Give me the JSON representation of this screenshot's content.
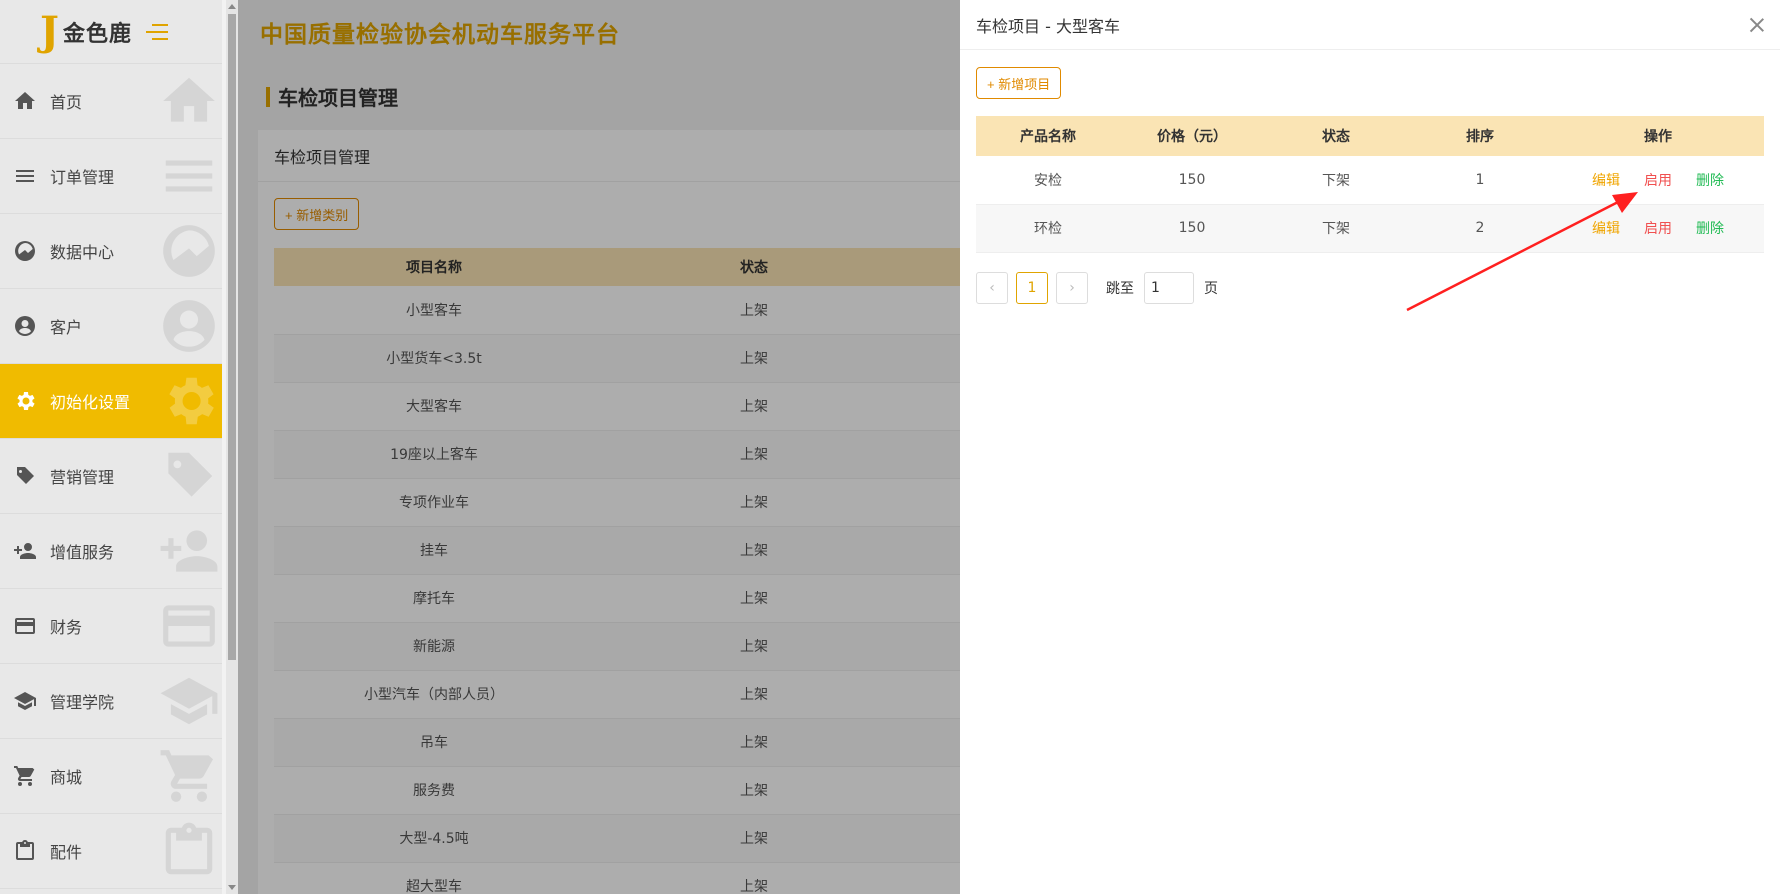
{
  "logo": {
    "mark": "J",
    "text": "金色鹿"
  },
  "sidebar": {
    "items": [
      {
        "label": "首页",
        "icon": "home-icon",
        "active": false
      },
      {
        "label": "订单管理",
        "icon": "list-icon",
        "active": false
      },
      {
        "label": "数据中心",
        "icon": "chart-icon",
        "active": false
      },
      {
        "label": "客户",
        "icon": "user-icon",
        "active": false
      },
      {
        "label": "初始化设置",
        "icon": "gear-icon",
        "active": true
      },
      {
        "label": "营销管理",
        "icon": "tag-icon",
        "active": false
      },
      {
        "label": "增值服务",
        "icon": "add-user-icon",
        "active": false
      },
      {
        "label": "财务",
        "icon": "card-icon",
        "active": false
      },
      {
        "label": "管理学院",
        "icon": "graduation-icon",
        "active": false
      },
      {
        "label": "商城",
        "icon": "cart-icon",
        "active": false
      },
      {
        "label": "配件",
        "icon": "clipboard-icon",
        "active": false
      }
    ]
  },
  "header": {
    "title": "中国质量检验协会机动车服务平台"
  },
  "page": {
    "title": "车检项目管理"
  },
  "card": {
    "title": "车检项目管理",
    "add_button": "+ 新增类别",
    "columns": [
      "项目名称",
      "状态"
    ],
    "rows": [
      {
        "name": "小型客车",
        "status": "上架"
      },
      {
        "name": "小型货车<3.5t",
        "status": "上架"
      },
      {
        "name": "大型客车",
        "status": "上架"
      },
      {
        "name": "19座以上客车",
        "status": "上架"
      },
      {
        "name": "专项作业车",
        "status": "上架"
      },
      {
        "name": "挂车",
        "status": "上架"
      },
      {
        "name": "摩托车",
        "status": "上架"
      },
      {
        "name": "新能源",
        "status": "上架"
      },
      {
        "name": "小型汽车（内部人员）",
        "status": "上架"
      },
      {
        "name": "吊车",
        "status": "上架"
      },
      {
        "name": "服务费",
        "status": "上架"
      },
      {
        "name": "大型-4.5吨",
        "status": "上架"
      },
      {
        "name": "超大型车",
        "status": "上架"
      }
    ]
  },
  "drawer": {
    "title": "车检项目 - 大型客车",
    "add_button": "+ 新增项目",
    "columns": [
      "产品名称",
      "价格（元）",
      "状态",
      "排序",
      "操作"
    ],
    "rows": [
      {
        "name": "安检",
        "price": "150",
        "status": "下架",
        "order": "1",
        "edit": "编辑",
        "enable": "启用",
        "delete": "删除"
      },
      {
        "name": "环检",
        "price": "150",
        "status": "下架",
        "order": "2",
        "edit": "编辑",
        "enable": "启用",
        "delete": "删除"
      }
    ],
    "pagination": {
      "prev": "‹",
      "current": "1",
      "next": "›",
      "goto_label": "跳至",
      "goto_value": "1",
      "page_suffix": "页"
    }
  },
  "colors": {
    "accent": "#f0bb00",
    "title_gold": "#e0a400",
    "edit": "#f0a500",
    "enable": "#f05050",
    "delete": "#22bb55",
    "arrow": "#ff2020"
  }
}
